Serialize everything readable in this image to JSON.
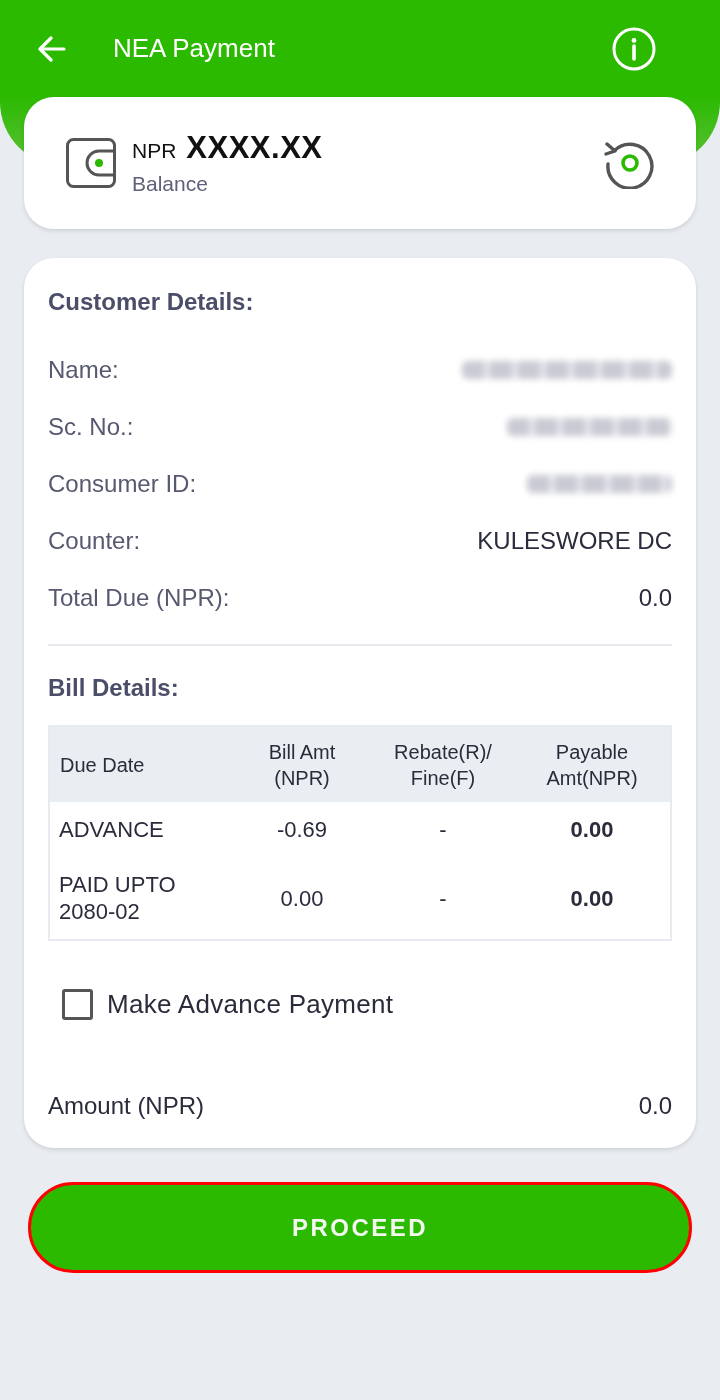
{
  "header": {
    "title": "NEA Payment"
  },
  "balance": {
    "currency": "NPR",
    "amount": "XXXX.XX",
    "label": "Balance"
  },
  "customer_details": {
    "heading": "Customer Details:",
    "rows": [
      {
        "label": "Name:",
        "blurred": true
      },
      {
        "label": "Sc. No.:",
        "blurred": true
      },
      {
        "label": "Consumer ID:",
        "blurred": true
      },
      {
        "label": "Counter:",
        "value": "KULESWORE DC",
        "blurred": false
      },
      {
        "label": "Total Due (NPR):",
        "value": "0.0",
        "blurred": false
      }
    ]
  },
  "bill_details": {
    "heading": "Bill Details:",
    "table": {
      "columns": [
        "Due Date",
        "Bill Amt (NPR)",
        "Rebate(R)/Fine(F)",
        "Payable Amt(NPR)"
      ],
      "rows": [
        [
          "ADVANCE",
          "-0.69",
          "-",
          "0.00"
        ],
        [
          "PAID UPTO 2080-02",
          "0.00",
          "-",
          "0.00"
        ]
      ]
    }
  },
  "advance_payment": {
    "label": "Make Advance Payment",
    "checked": false
  },
  "amount": {
    "label": "Amount (NPR)",
    "value": "0.0"
  },
  "proceed_button": {
    "label": "PROCEED",
    "highlighted": true
  }
}
